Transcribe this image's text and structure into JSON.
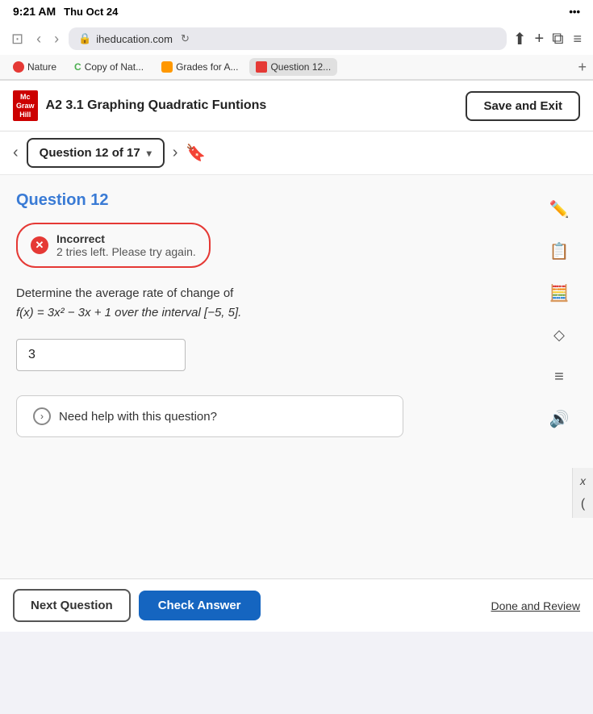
{
  "statusBar": {
    "time": "9:21 AM",
    "date": "Thu Oct 24",
    "dots": "•••"
  },
  "browserToolbar": {
    "backBtn": "‹",
    "forwardBtn": "›",
    "addressText": "iheducation.com",
    "shareIcon": "⬆",
    "addIcon": "+",
    "tabsIcon": "⧉",
    "menuIcon": "≡"
  },
  "tabs": [
    {
      "label": "Nature",
      "active": false,
      "faviconType": "red"
    },
    {
      "label": "Copy of Nat...",
      "active": false,
      "faviconType": "green"
    },
    {
      "label": "Grades for A...",
      "active": false,
      "faviconType": "orange"
    },
    {
      "label": "Question 12...",
      "active": true,
      "faviconType": "red"
    }
  ],
  "appHeader": {
    "logoLine1": "Mc",
    "logoLine2": "Graw",
    "logoLine3": "Hill",
    "title": "A2 3.1 Graphing Quadratic Funtions",
    "saveExitLabel": "Save and Exit"
  },
  "questionNav": {
    "backArrow": "‹",
    "questionLabel": "Question 12 of 17",
    "chevron": "▾",
    "nextArrow": "›",
    "bookmarkIcon": "🔖"
  },
  "question": {
    "title": "Question 12",
    "incorrectLabel": "Incorrect",
    "incorrectDetail": "2 tries left. Please try again.",
    "bodyText": "Determine the average rate of change of",
    "formula": "f(x) = 3x² − 3x + 1 over the interval [−5, 5].",
    "answerValue": "3",
    "helpText": "Need help with this question?"
  },
  "toolPanel": {
    "pencilIcon": "✏",
    "listIcon": "☰",
    "calcIcon": "⊞",
    "eraserIcon": "◊",
    "equalIcon": "≡",
    "speakerIcon": "🔊"
  },
  "bottomBar": {
    "nextQuestionLabel": "Next Question",
    "checkAnswerLabel": "Check Answer",
    "doneReviewLabel": "Done and Review"
  },
  "rightSidebar": {
    "xLabel": "x",
    "parenLabel": "("
  }
}
